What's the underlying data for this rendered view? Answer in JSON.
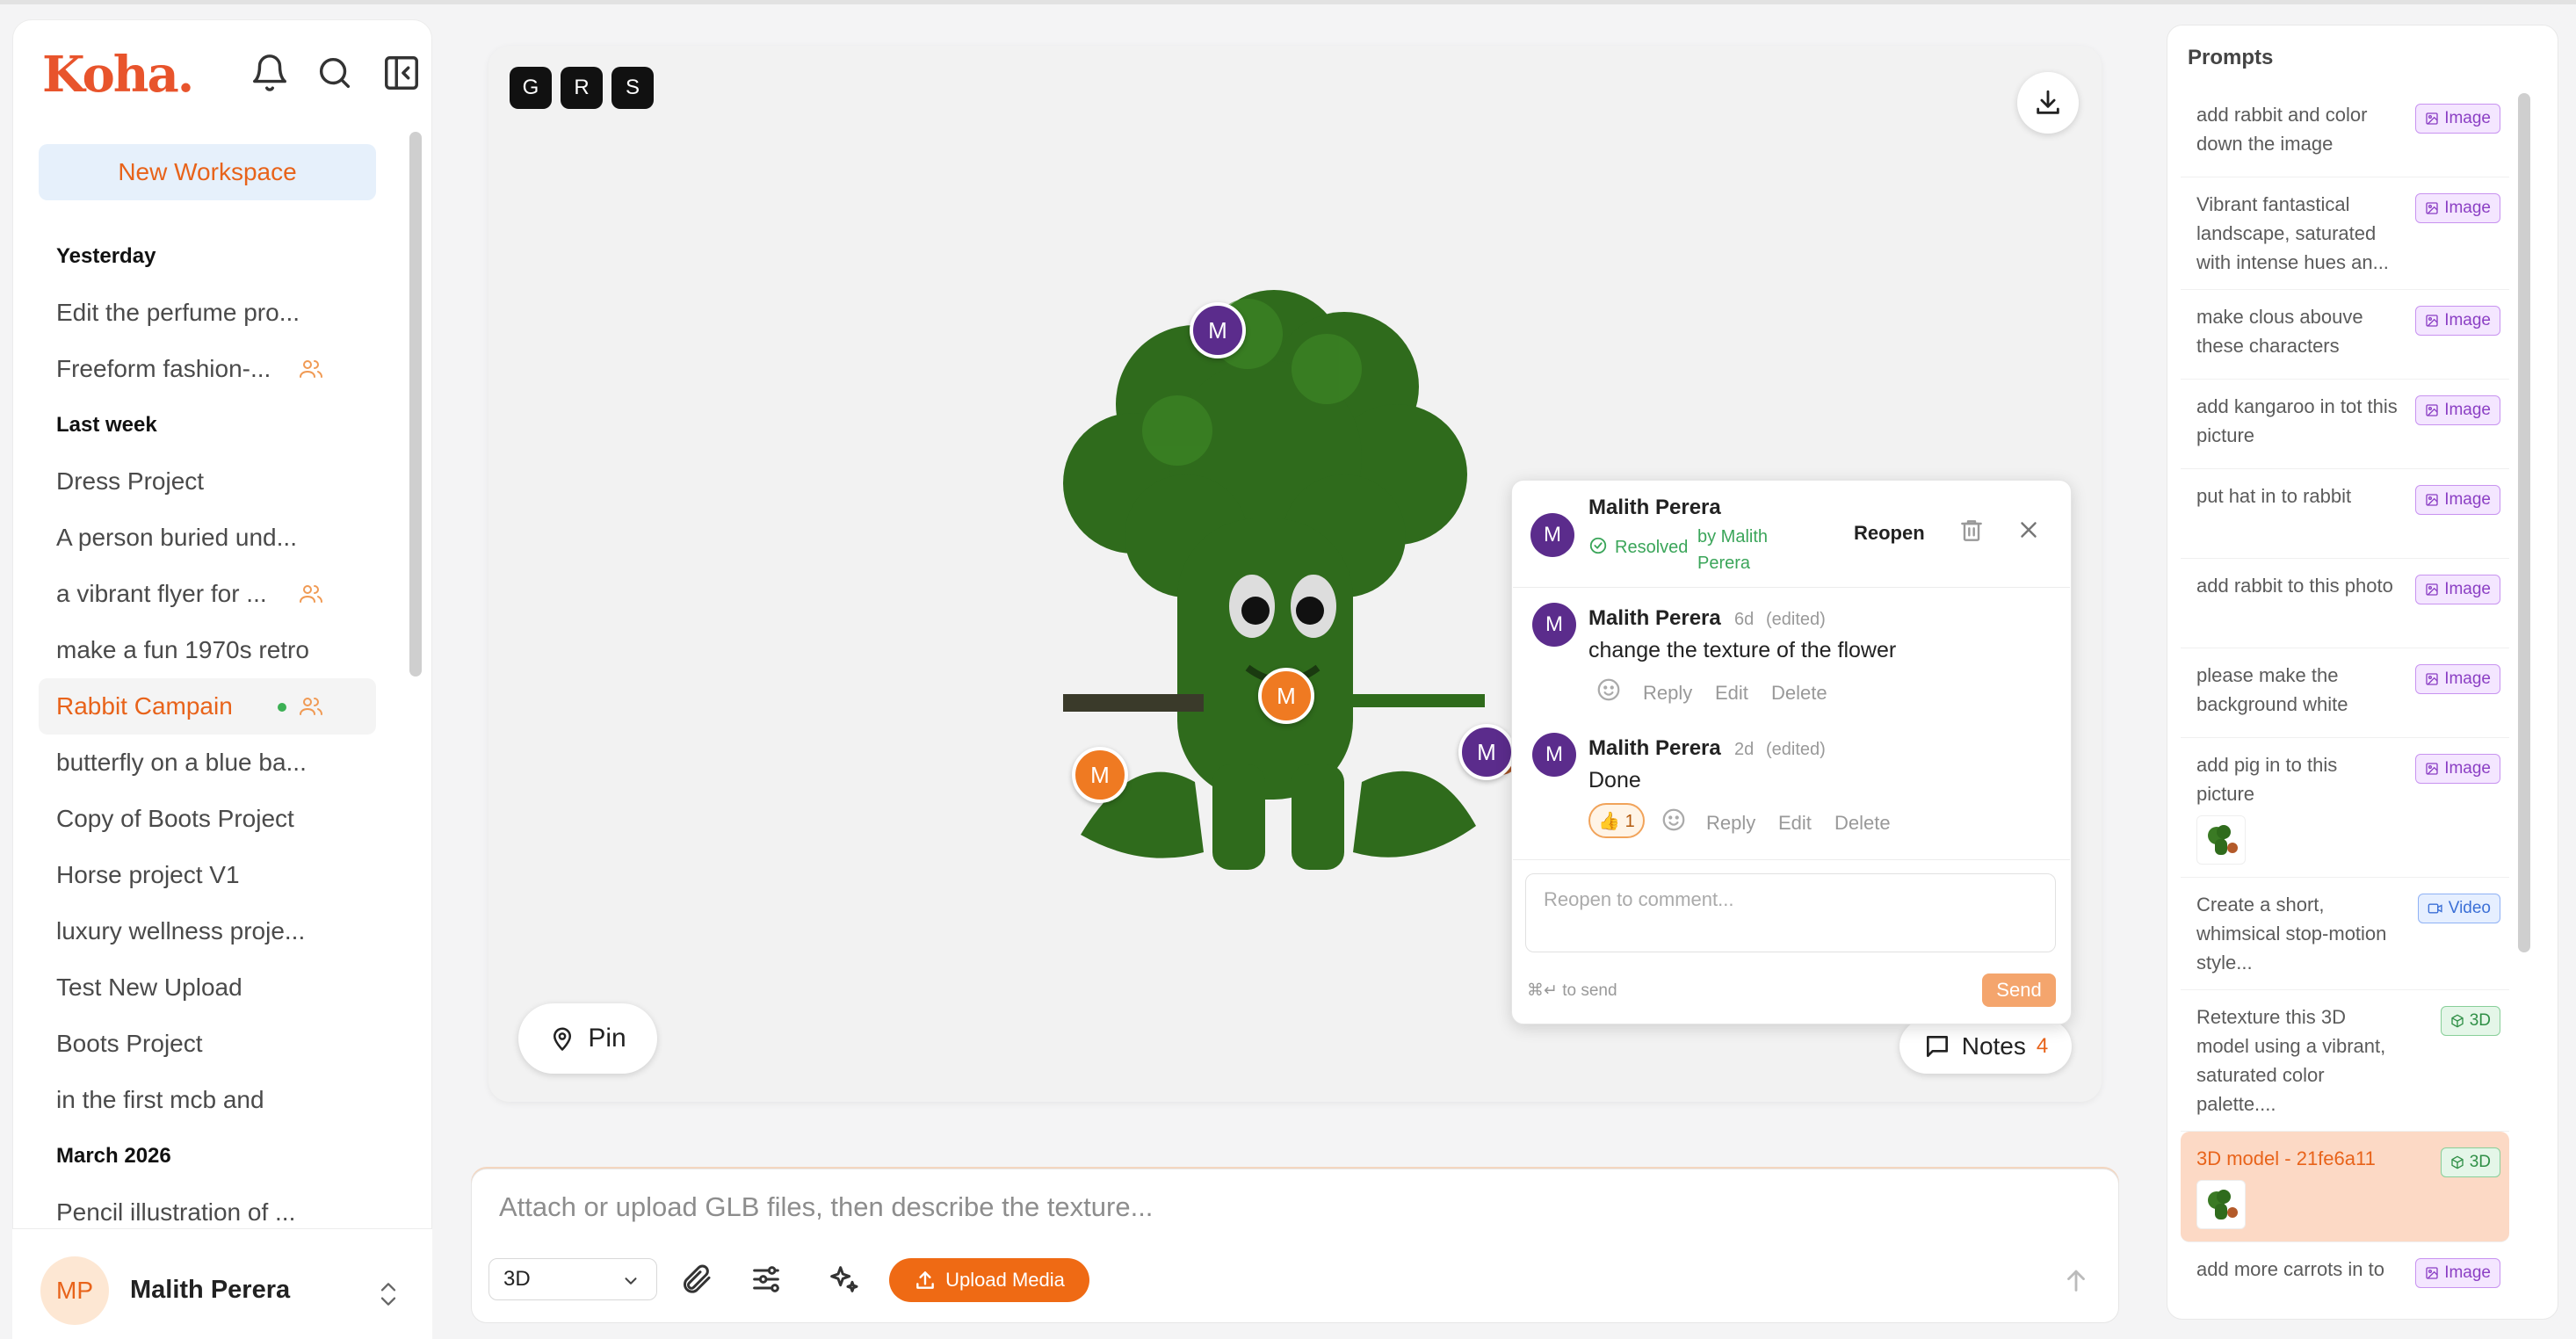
{
  "app": {
    "logo": "Koha",
    "logo_dot": "."
  },
  "sidebar": {
    "new_workspace": "New Workspace",
    "sections": [
      {
        "title": "Yesterday",
        "items": [
          {
            "label": "Edit the perfume pro...",
            "shared": false,
            "active": false
          },
          {
            "label": "Freeform fashion-...",
            "shared": true,
            "active": false
          }
        ]
      },
      {
        "title": "Last week",
        "items": [
          {
            "label": "Dress Project",
            "shared": false,
            "active": false
          },
          {
            "label": "A person buried und...",
            "shared": false,
            "active": false
          },
          {
            "label": "a vibrant flyer for ...",
            "shared": true,
            "active": false
          },
          {
            "label": "make a fun 1970s retro",
            "shared": false,
            "active": false
          },
          {
            "label": "Rabbit Campain",
            "shared": true,
            "active": true,
            "online": true
          },
          {
            "label": "butterfly on a blue ba...",
            "shared": false,
            "active": false
          },
          {
            "label": "Copy of Boots Project",
            "shared": false,
            "active": false
          },
          {
            "label": "Horse project V1",
            "shared": false,
            "active": false
          },
          {
            "label": "luxury wellness proje...",
            "shared": false,
            "active": false
          },
          {
            "label": "Test New Upload",
            "shared": false,
            "active": false
          },
          {
            "label": "Boots Project",
            "shared": false,
            "active": false
          },
          {
            "label": "in the first mcb and",
            "shared": false,
            "active": false
          }
        ]
      },
      {
        "title": "March 2026",
        "items": [
          {
            "label": "Pencil illustration of ...",
            "shared": false,
            "active": false
          }
        ]
      }
    ],
    "user": {
      "initials": "MP",
      "name": "Malith Perera"
    }
  },
  "canvas": {
    "shortcuts": [
      "G",
      "R",
      "S"
    ],
    "markers": [
      {
        "initial": "M",
        "color": "purple"
      },
      {
        "initial": "M",
        "color": "orange"
      },
      {
        "initial": "M",
        "color": "orange"
      },
      {
        "initial": "M",
        "color": "purple"
      }
    ],
    "pin_label": "Pin",
    "notes_label": "Notes",
    "notes_count": "4"
  },
  "thread": {
    "author": "Malith Perera",
    "avatar": "M",
    "resolved_label": "Resolved",
    "resolved_by": "by Malith Perera",
    "reopen_label": "Reopen",
    "comments": [
      {
        "author": "Malith Perera",
        "avatar": "M",
        "age": "6d",
        "edited": "(edited)",
        "text": "change the texture of the flower",
        "reply": "Reply",
        "edit": "Edit",
        "delete": "Delete"
      },
      {
        "author": "Malith Perera",
        "avatar": "M",
        "age": "2d",
        "edited": "(edited)",
        "text": "Done",
        "reaction": "👍 1",
        "reply": "Reply",
        "edit": "Edit",
        "delete": "Delete"
      }
    ],
    "input_placeholder": "Reopen to comment...",
    "hint": "⌘↵ to send",
    "send_label": "Send"
  },
  "promptbar": {
    "placeholder": "Attach or upload GLB files, then describe the texture...",
    "mode": "3D",
    "upload_label": "Upload Media"
  },
  "prompts": {
    "title": "Prompts",
    "items": [
      {
        "text": "add rabbit and color down the image",
        "type": "Image",
        "kind": "image",
        "thumb": false,
        "active": false
      },
      {
        "text": "Vibrant fantastical landscape, saturated with intense hues an...",
        "type": "Image",
        "kind": "image",
        "thumb": false,
        "active": false
      },
      {
        "text": "make clous abouve these characters",
        "type": "Image",
        "kind": "image",
        "thumb": false,
        "active": false
      },
      {
        "text": "add kangaroo in tot this picture",
        "type": "Image",
        "kind": "image",
        "thumb": false,
        "active": false
      },
      {
        "text": "put hat in to rabbit",
        "type": "Image",
        "kind": "image",
        "thumb": false,
        "active": false
      },
      {
        "text": "add rabbit to this photo",
        "type": "Image",
        "kind": "image",
        "thumb": false,
        "active": false
      },
      {
        "text": "please make the background white",
        "type": "Image",
        "kind": "image",
        "thumb": false,
        "active": false
      },
      {
        "text": "add pig in to this picture",
        "type": "Image",
        "kind": "image",
        "thumb": true,
        "active": false
      },
      {
        "text": "Create a short, whimsical stop-motion style...",
        "type": "Video",
        "kind": "video",
        "thumb": false,
        "active": false
      },
      {
        "text": "Retexture this 3D model using a vibrant, saturated color palette....",
        "type": "3D",
        "kind": "d3",
        "thumb": false,
        "active": false
      },
      {
        "text": "3D model - 21fe6a11",
        "type": "3D",
        "kind": "d3",
        "thumb": true,
        "active": true
      },
      {
        "text": "add more carrots in to",
        "type": "Image",
        "kind": "image",
        "thumb": false,
        "active": false
      }
    ]
  }
}
